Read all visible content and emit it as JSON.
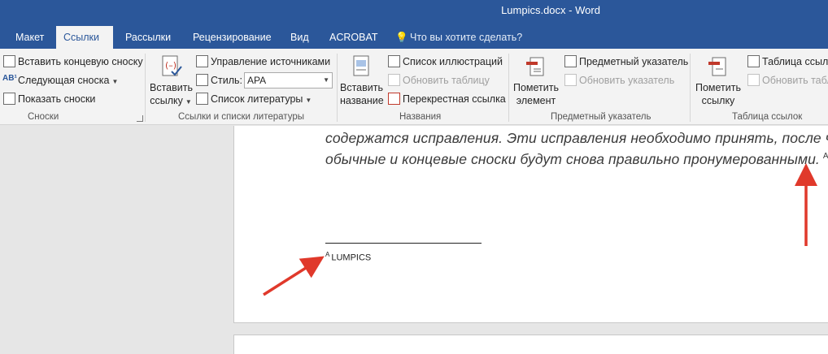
{
  "window": {
    "title": "Lumpics.docx - Word"
  },
  "tabs": [
    {
      "label": "Макет"
    },
    {
      "label": "Ссылки",
      "active": true
    },
    {
      "label": "Рассылки"
    },
    {
      "label": "Рецензирование"
    },
    {
      "label": "Вид"
    },
    {
      "label": "ACROBAT"
    }
  ],
  "tell_me": {
    "text": "Что вы хотите сделать?"
  },
  "ribbon": {
    "footnotes": {
      "insert_endnote": "Вставить концевую сноску",
      "next_footnote": "Следующая сноска",
      "show_notes": "Показать сноски",
      "group_label": "Сноски"
    },
    "citations": {
      "insert_citation_line1": "Вставить",
      "insert_citation_line2": "ссылку",
      "manage_sources": "Управление источниками",
      "style_label": "Стиль:",
      "style_value": "APA",
      "bibliography": "Список литературы",
      "group_label": "Ссылки и списки литературы"
    },
    "captions": {
      "insert_caption_line1": "Вставить",
      "insert_caption_line2": "название",
      "table_of_figures": "Список иллюстраций",
      "update_table": "Обновить таблицу",
      "cross_reference": "Перекрестная ссылка",
      "group_label": "Названия"
    },
    "index": {
      "mark_entry_line1": "Пометить",
      "mark_entry_line2": "элемент",
      "insert_index": "Предметный указатель",
      "update_index": "Обновить указатель",
      "group_label": "Предметный указатель"
    },
    "toa": {
      "mark_citation_line1": "Пометить",
      "mark_citation_line2": "ссылку",
      "insert_toa": "Таблица ссылок",
      "update_toa": "Обновить таблицу",
      "group_label": "Таблица ссылок"
    }
  },
  "document": {
    "line1": "содержатся исправления. Эти исправления необходимо принять, после чего",
    "line2": "обычные и концевые сноски будут снова правильно пронумерованными.",
    "endnote_ref_mark": "A",
    "footnote_mark": "A",
    "footnote_text": "LUMPICS"
  },
  "colors": {
    "word_blue": "#2b579a",
    "ribbon_bg": "#f3f3f3",
    "arrow_red": "#e0392b"
  }
}
